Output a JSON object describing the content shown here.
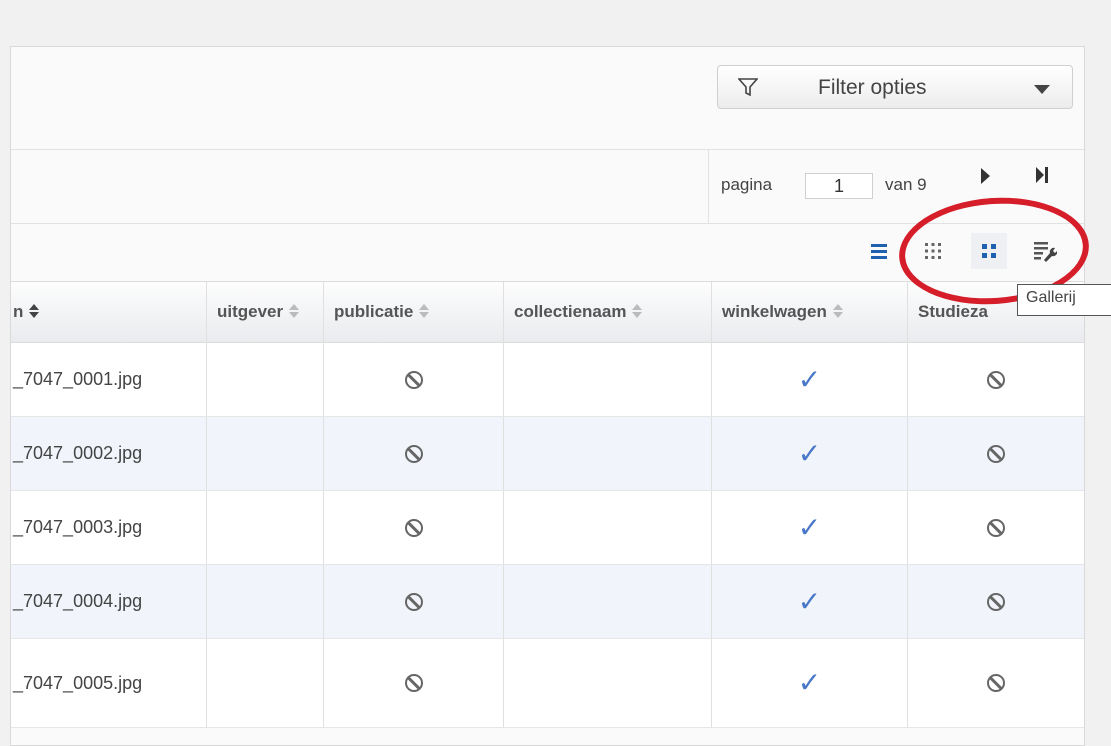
{
  "toolbar": {
    "filter_label": "Filter opties",
    "filter_icon": "funnel-icon",
    "caret_icon": "chevron-down-icon"
  },
  "pager": {
    "page_label": "pagina",
    "page_value": "1",
    "of_label": "van 9"
  },
  "view_modes": [
    "list-view-icon",
    "small-grid-icon",
    "large-grid-icon",
    "gallery-settings-icon"
  ],
  "table": {
    "columns": [
      "n",
      "uitgever",
      "publicatie",
      "collectienaam",
      "winkelwagen",
      "Studieza"
    ],
    "rows": [
      {
        "file": "_7047_0001.jpg",
        "publicatie": "ban",
        "winkelwagen": "check",
        "studiezaal": "ban"
      },
      {
        "file": "_7047_0002.jpg",
        "publicatie": "ban",
        "winkelwagen": "check",
        "studiezaal": "ban"
      },
      {
        "file": "_7047_0003.jpg",
        "publicatie": "ban",
        "winkelwagen": "check",
        "studiezaal": "ban"
      },
      {
        "file": "_7047_0004.jpg",
        "publicatie": "ban",
        "winkelwagen": "check",
        "studiezaal": "ban"
      },
      {
        "file": "_7047_0005.jpg",
        "publicatie": "ban",
        "winkelwagen": "check",
        "studiezaal": "ban"
      }
    ]
  },
  "tooltip": "Gallerij",
  "colors": {
    "highlight": "#d61e2a",
    "check": "#4a78c8",
    "active_view": "#2060b0"
  }
}
